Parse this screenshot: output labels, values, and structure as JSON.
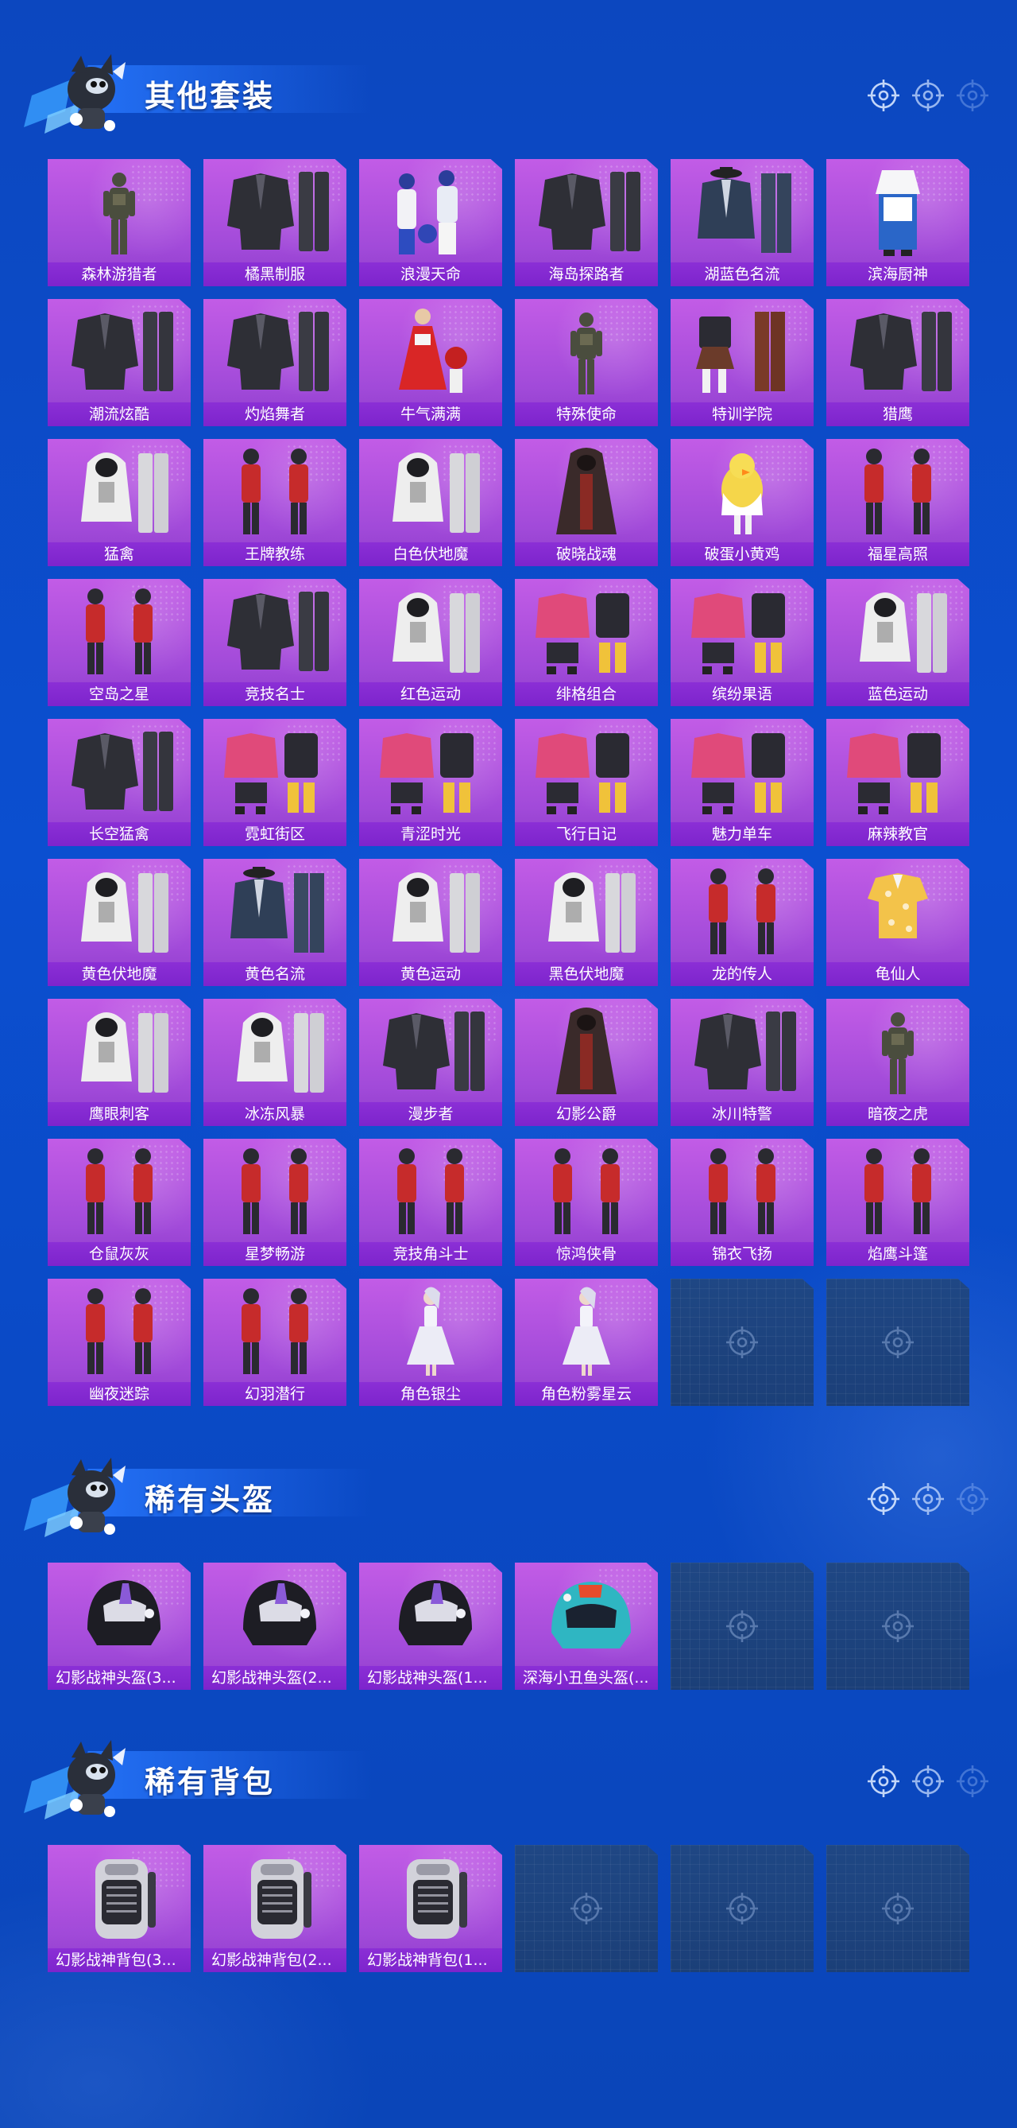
{
  "sections": [
    {
      "title": "其他套装",
      "items": [
        {
          "label": "森林游猎者",
          "art": "soldier"
        },
        {
          "label": "橘黑制服",
          "art": "jacket-pants"
        },
        {
          "label": "浪漫天命",
          "art": "group"
        },
        {
          "label": "海岛探路者",
          "art": "jacket-pants"
        },
        {
          "label": "湖蓝色名流",
          "art": "suit"
        },
        {
          "label": "滨海厨神",
          "art": "chef"
        },
        {
          "label": "潮流炫酷",
          "art": "jacket-pants"
        },
        {
          "label": "灼焰舞者",
          "art": "jacket-pants"
        },
        {
          "label": "牛气满满",
          "art": "dress"
        },
        {
          "label": "特殊使命",
          "art": "soldier"
        },
        {
          "label": "特训学院",
          "art": "school"
        },
        {
          "label": "猎鹰",
          "art": "jacket-pants"
        },
        {
          "label": "猛禽",
          "art": "hooded"
        },
        {
          "label": "王牌教练",
          "art": "pair"
        },
        {
          "label": "白色伏地魔",
          "art": "hooded"
        },
        {
          "label": "破晓战魂",
          "art": "robe"
        },
        {
          "label": "破蛋小黄鸡",
          "art": "chick"
        },
        {
          "label": "福星高照",
          "art": "pair"
        },
        {
          "label": "空岛之星",
          "art": "pair"
        },
        {
          "label": "竞技名士",
          "art": "jacket-pants"
        },
        {
          "label": "红色运动",
          "art": "hooded"
        },
        {
          "label": "绯格组合",
          "art": "set"
        },
        {
          "label": "缤纷果语",
          "art": "set"
        },
        {
          "label": "蓝色运动",
          "art": "hooded"
        },
        {
          "label": "长空猛禽",
          "art": "jacket-pants"
        },
        {
          "label": "霓虹街区",
          "art": "set"
        },
        {
          "label": "青涩时光",
          "art": "set"
        },
        {
          "label": "飞行日记",
          "art": "set"
        },
        {
          "label": "魅力单车",
          "art": "set"
        },
        {
          "label": "麻辣教官",
          "art": "set"
        },
        {
          "label": "黄色伏地魔",
          "art": "hooded"
        },
        {
          "label": "黄色名流",
          "art": "suit"
        },
        {
          "label": "黄色运动",
          "art": "hooded"
        },
        {
          "label": "黑色伏地魔",
          "art": "hooded"
        },
        {
          "label": "龙的传人",
          "art": "pair"
        },
        {
          "label": "龟仙人",
          "art": "shirt"
        },
        {
          "label": "鹰眼刺客",
          "art": "hooded"
        },
        {
          "label": "冰冻风暴",
          "art": "hooded"
        },
        {
          "label": "漫步者",
          "art": "jacket-pants"
        },
        {
          "label": "幻影公爵",
          "art": "robe"
        },
        {
          "label": "冰川特警",
          "art": "jacket-pants"
        },
        {
          "label": "暗夜之虎",
          "art": "soldier"
        },
        {
          "label": "仓鼠灰灰",
          "art": "pair"
        },
        {
          "label": "星梦畅游",
          "art": "pair"
        },
        {
          "label": "竞技角斗士",
          "art": "pair"
        },
        {
          "label": "惊鸿侠骨",
          "art": "pair"
        },
        {
          "label": "锦衣飞扬",
          "art": "pair"
        },
        {
          "label": "焰鹰斗篷",
          "art": "pair"
        },
        {
          "label": "幽夜迷踪",
          "art": "pair"
        },
        {
          "label": "幻羽潜行",
          "art": "pair"
        },
        {
          "label": "角色银尘",
          "art": "dress-figure"
        },
        {
          "label": "角色粉雾星云",
          "art": "dress-figure"
        }
      ],
      "empty_slots": 2
    },
    {
      "title": "稀有头盔",
      "items": [
        {
          "label": "幻影战神头盔(3...",
          "art": "helmet"
        },
        {
          "label": "幻影战神头盔(2...",
          "art": "helmet"
        },
        {
          "label": "幻影战神头盔(1...",
          "art": "helmet"
        },
        {
          "label": "深海小丑鱼头盔(...",
          "art": "helmet-teal"
        }
      ],
      "empty_slots": 2
    },
    {
      "title": "稀有背包",
      "items": [
        {
          "label": "幻影战神背包(3...",
          "art": "backpack"
        },
        {
          "label": "幻影战神背包(2...",
          "art": "backpack"
        },
        {
          "label": "幻影战神背包(1...",
          "art": "backpack"
        }
      ],
      "empty_slots": 3
    }
  ],
  "colors": {
    "background": "#0b4bc4",
    "card_fill": "#b152e0",
    "label_bar": "#8328d2",
    "empty_slot": "#1d437e",
    "title_text": "#ffffff"
  }
}
